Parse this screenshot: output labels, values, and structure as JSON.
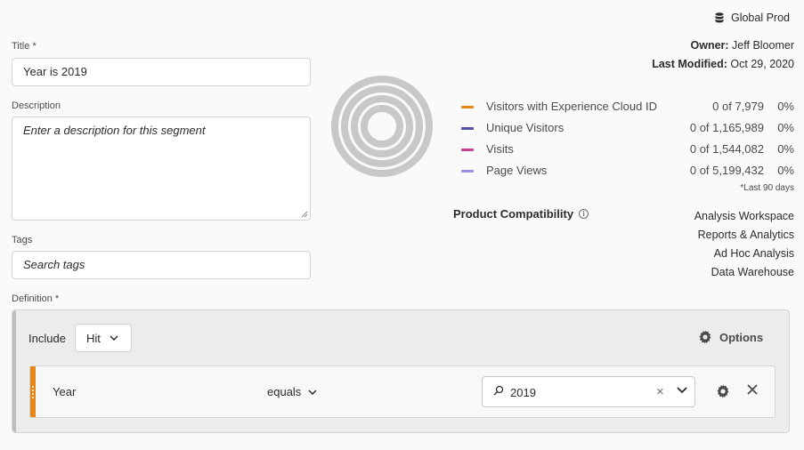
{
  "form": {
    "title_label": "Title",
    "title_required": "*",
    "title_value": "Year is 2019",
    "description_label": "Description",
    "description_placeholder": "Enter a description for this segment",
    "tags_label": "Tags",
    "tags_placeholder": "Search tags",
    "definition_label": "Definition",
    "definition_required": "*"
  },
  "header": {
    "report_suite": "Global Prod",
    "owner_label": "Owner:",
    "owner_value": "Jeff Bloomer",
    "modified_label": "Last Modified:",
    "modified_value": "Oct 29, 2020"
  },
  "metrics": [
    {
      "label": "Visitors with Experience Cloud ID",
      "count": "0 of 7,979",
      "pct": "0%",
      "color": "#e68619"
    },
    {
      "label": "Unique Visitors",
      "count": "0 of 1,165,989",
      "pct": "0%",
      "color": "#5151a8"
    },
    {
      "label": "Visits",
      "count": "0 of 1,544,082",
      "pct": "0%",
      "color": "#c74192"
    },
    {
      "label": "Page Views",
      "count": "0 of 5,199,432",
      "pct": "0%",
      "color": "#9d8ede"
    }
  ],
  "metrics_note": "*Last 90 days",
  "compatibility": {
    "title": "Product Compatibility",
    "products": [
      "Analysis Workspace",
      "Reports & Analytics",
      "Ad Hoc Analysis",
      "Data Warehouse"
    ]
  },
  "definition": {
    "include_label": "Include",
    "container_value": "Hit",
    "options_label": "Options",
    "rule": {
      "dimension": "Year",
      "operator": "equals",
      "value": "2019"
    }
  },
  "colors": {
    "accent_orange": "#e68619",
    "donut_gray": "#c8c8c8"
  }
}
